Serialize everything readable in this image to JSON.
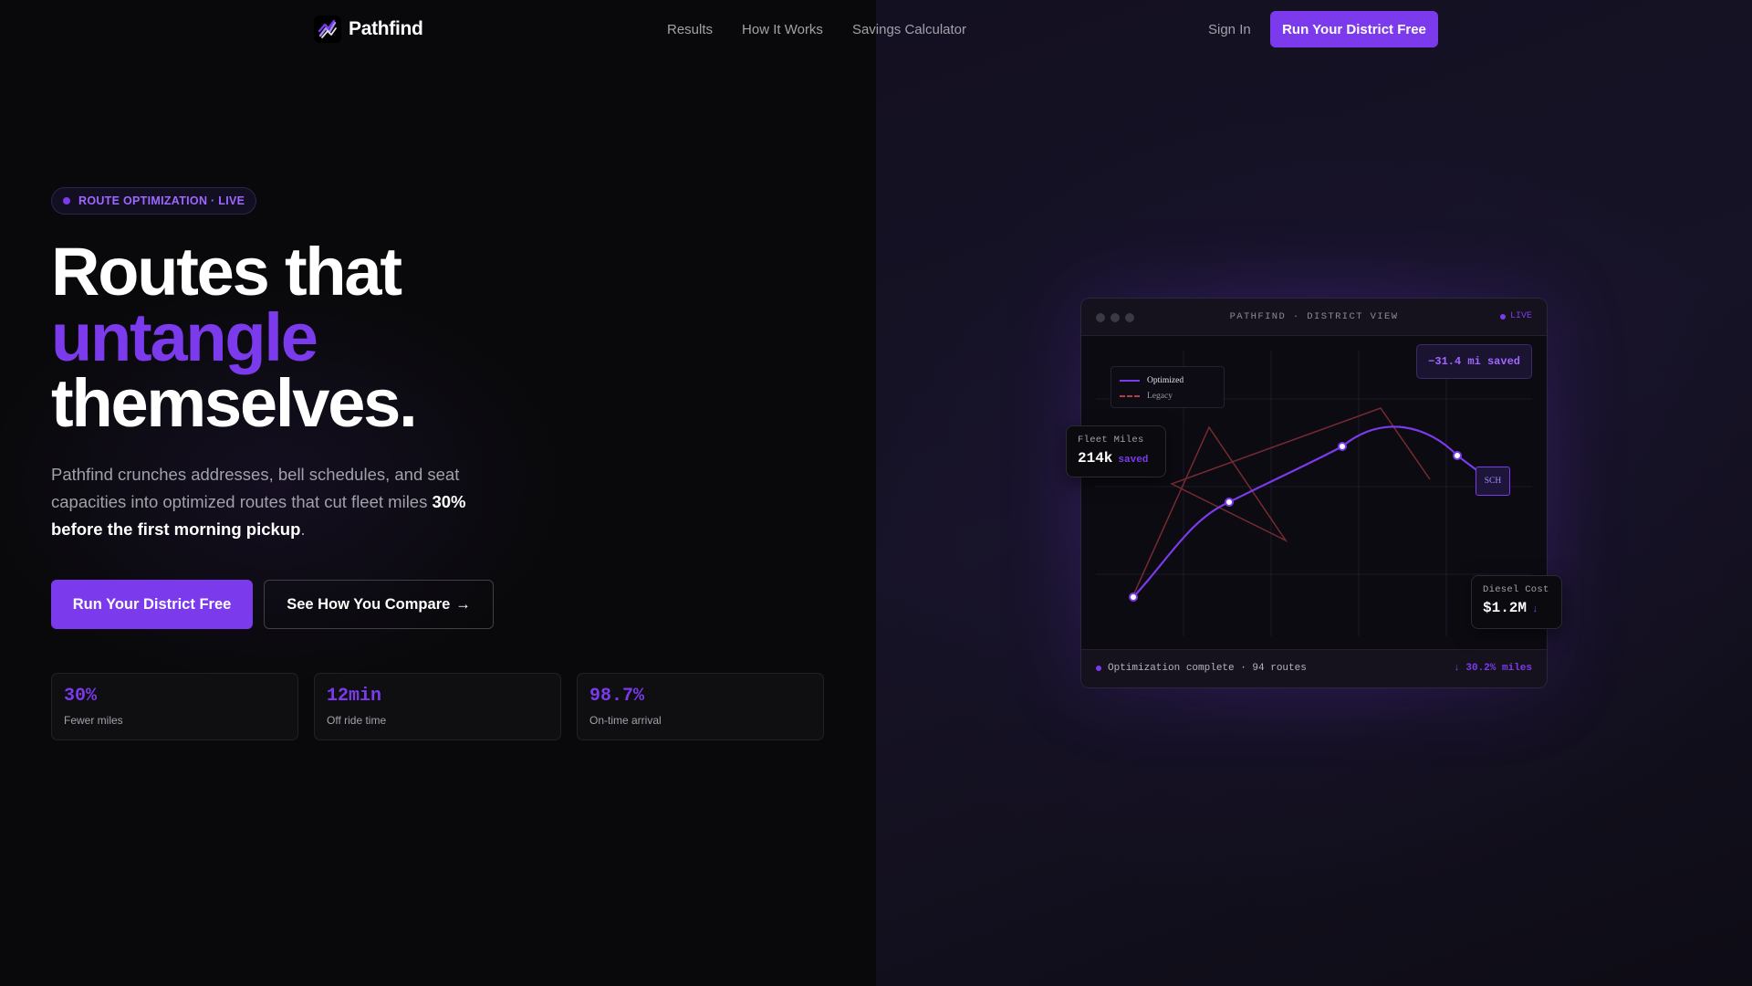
{
  "nav": {
    "brand": "Pathfind",
    "links": [
      "Results",
      "How It Works",
      "Savings Calculator"
    ],
    "sign_in": "Sign In",
    "cta": "Run Your District Free"
  },
  "hero": {
    "badge": "ROUTE OPTIMIZATION · LIVE",
    "headline_line1": "Routes that",
    "headline_accent": "untangle",
    "headline_line3": "themselves.",
    "subcopy_pre": "Pathfind crunches addresses, bell schedules, and seat capacities into optimized routes that cut fleet miles ",
    "subcopy_bold": "30% before the first morning pickup",
    "subcopy_post": ".",
    "primary_button": "Run Your District Free",
    "secondary_button": "See How You Compare",
    "secondary_arrow": "→",
    "stats": [
      {
        "value": "30%",
        "label": "Fewer miles"
      },
      {
        "value": "12min",
        "label": "Off ride time"
      },
      {
        "value": "98.7%",
        "label": "On-time arrival"
      }
    ]
  },
  "mock": {
    "title": "PATHFIND · DISTRICT VIEW",
    "live": "LIVE",
    "saved_pill": "−31.4 mi saved",
    "legend_optimized": "Optimized",
    "legend_legacy": "Legacy",
    "school_label": "SCH",
    "footer_left": "Optimization complete · 94 routes",
    "footer_right": "↓ 30.2% miles",
    "fleet_label": "Fleet Miles",
    "fleet_value": "214k",
    "fleet_suffix": "saved",
    "diesel_label": "Diesel Cost",
    "diesel_value": "$1.2M",
    "diesel_suffix": "↓"
  },
  "colors": {
    "accent": "#7c3aed",
    "background": "#09090b",
    "legacy_route": "#b04044"
  },
  "icons": {
    "brand": "route-logo-icon"
  }
}
